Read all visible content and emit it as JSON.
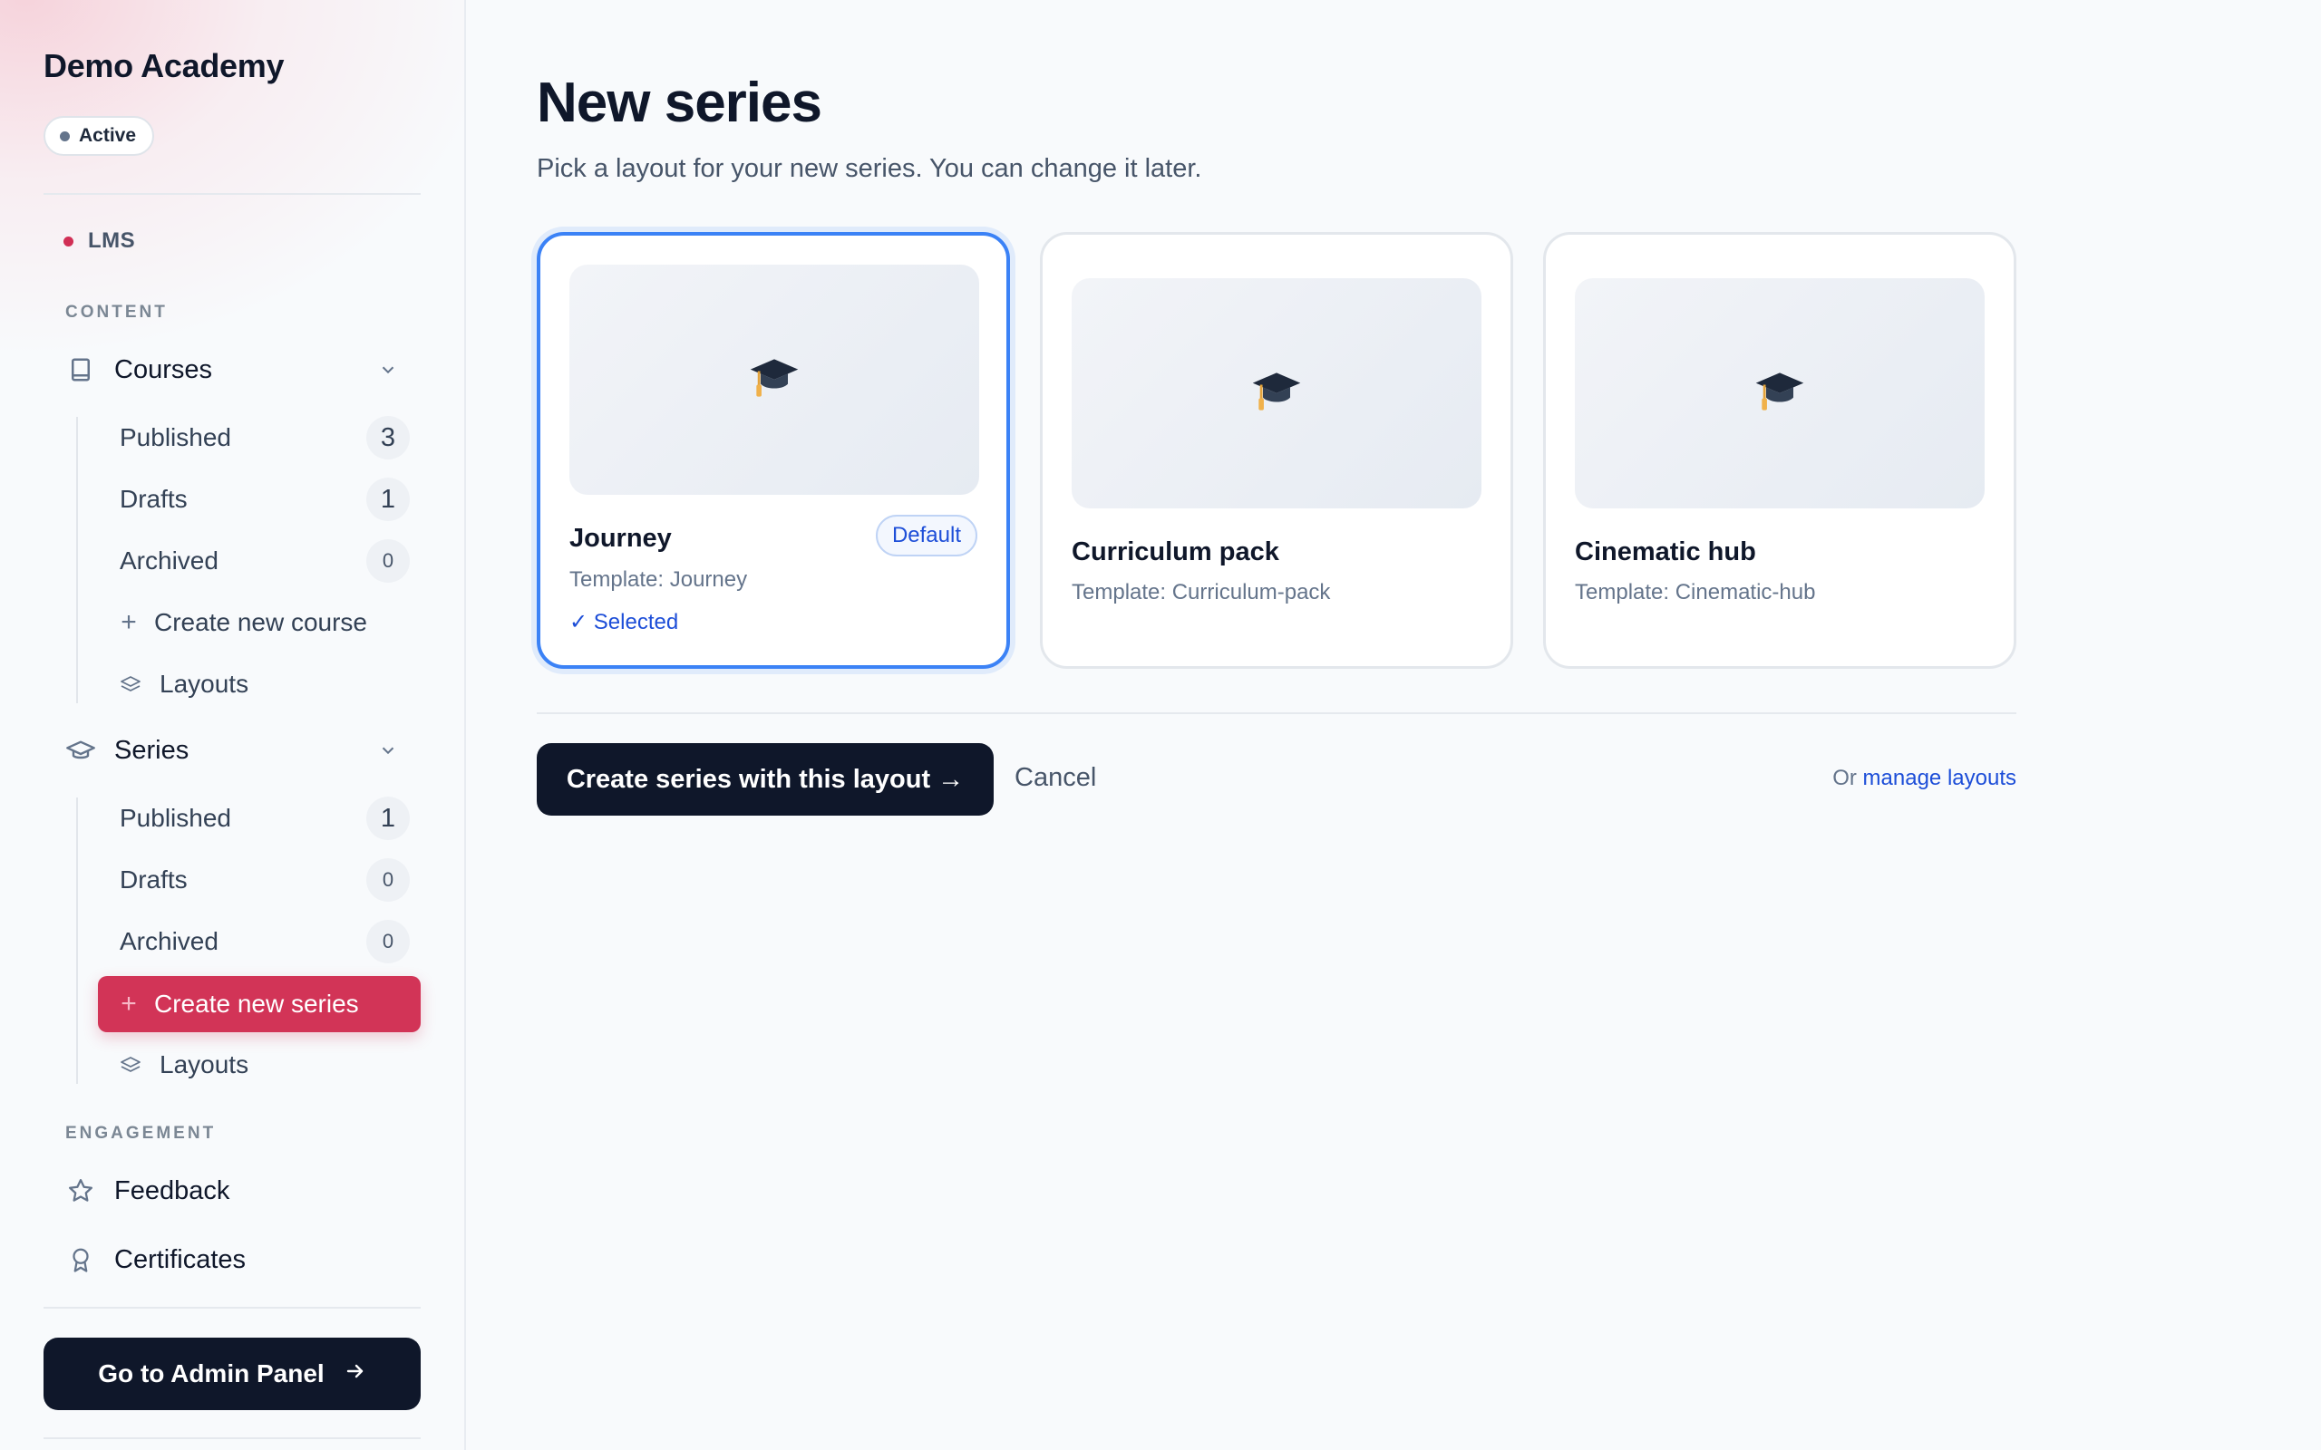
{
  "sidebar": {
    "brand": "Demo Academy",
    "status": "Active",
    "app_label": "LMS",
    "sections": {
      "content": "CONTENT",
      "engagement": "ENGAGEMENT"
    },
    "courses": {
      "label": "Courses",
      "items": [
        {
          "label": "Published",
          "count": "3"
        },
        {
          "label": "Drafts",
          "count": "1"
        },
        {
          "label": "Archived",
          "count": "0"
        }
      ],
      "create": "Create new course",
      "layouts": "Layouts"
    },
    "series": {
      "label": "Series",
      "items": [
        {
          "label": "Published",
          "count": "1"
        },
        {
          "label": "Drafts",
          "count": "0"
        },
        {
          "label": "Archived",
          "count": "0"
        }
      ],
      "create": "Create new series",
      "layouts": "Layouts"
    },
    "engagement_items": [
      {
        "label": "Feedback",
        "icon": "star-icon"
      },
      {
        "label": "Certificates",
        "icon": "award-icon"
      }
    ],
    "admin_button": "Go to Admin Panel"
  },
  "main": {
    "title": "New series",
    "subtitle": "Pick a layout for your new series. You can change it later.",
    "layouts": [
      {
        "name": "Journey",
        "template": "Template: Journey",
        "badge": "Default",
        "selected_text": "✓ Selected",
        "icon": "graduation-cap-icon"
      },
      {
        "name": "Curriculum pack",
        "template": "Template: Curriculum-pack",
        "icon": "graduation-cap-icon"
      },
      {
        "name": "Cinematic hub",
        "template": "Template: Cinematic-hub",
        "icon": "graduation-cap-icon"
      }
    ],
    "primary_button": "Create series with this layout →",
    "cancel": "Cancel",
    "manage_prefix": "Or",
    "manage_link": "manage layouts"
  },
  "colors": {
    "accent": "#d23457",
    "primary_dark": "#0f172a",
    "link_blue": "#1d4ed8",
    "selected_border": "#3b82f6"
  }
}
